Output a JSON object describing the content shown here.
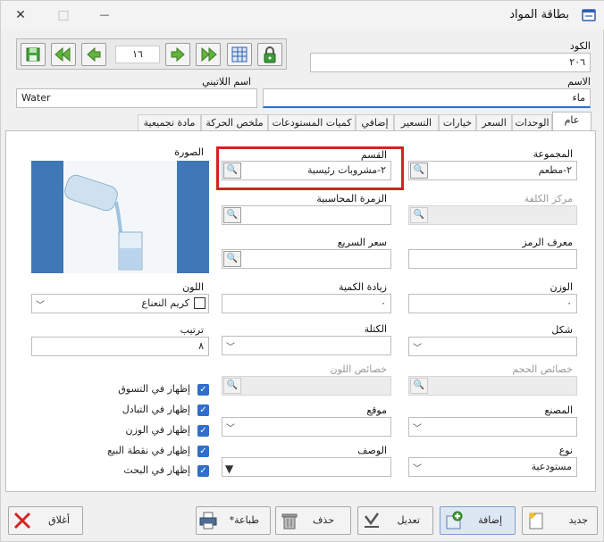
{
  "window": {
    "title": "بطاقة المواد",
    "minimize": "—",
    "maximize": "□",
    "close": "✕"
  },
  "toolbar": {
    "page_number": "١٦"
  },
  "header": {
    "code_label": "الكود",
    "code_value": "٢٠٦",
    "name_label": "الاسم",
    "name_value": "ماء",
    "latin_label": "اسم اللاتيني",
    "latin_value": "Water"
  },
  "tabs": [
    {
      "label": "عام"
    },
    {
      "label": "الوحدات"
    },
    {
      "label": "السعر"
    },
    {
      "label": "خيارات"
    },
    {
      "label": "التسعير"
    },
    {
      "label": "إضافي"
    },
    {
      "label": "كميات المستودعات"
    },
    {
      "label": "ملخص الحركة"
    },
    {
      "label": "مادة تجميعية"
    }
  ],
  "general": {
    "group_label": "المجموعة",
    "group_value": "٢-مطعم",
    "section_label": "القسم",
    "section_value": "٢-مشروبات رئيسية",
    "image_label": "الصورة",
    "cost_center_label": "مركز الكلفة",
    "accounting_group_label": "الزمرة المحاسبية",
    "symbol_id_label": "معرف الرمز",
    "quick_price_label": "سعر السريع",
    "weight_label": "الوزن",
    "weight_value": "٠",
    "qty_increase_label": "زيادة الكمية",
    "qty_increase_value": "٠",
    "color_label": "اللون",
    "color_value": "كريم النعناع",
    "shape_label": "شكل",
    "block_label": "الكتلة",
    "order_label": "ترتيب",
    "order_value": "٨",
    "size_props_label": "خصائص الحجم",
    "color_props_label": "خصائص اللون",
    "manufacturer_label": "المصنع",
    "location_label": "موقع",
    "type_label": "نوع",
    "type_value": "مستودعية",
    "description_label": "الوصف",
    "checks": [
      {
        "label": "إظهار في التسوق",
        "checked": true
      },
      {
        "label": "إظهار في التبادل",
        "checked": true
      },
      {
        "label": "إظهار في الوزن",
        "checked": true
      },
      {
        "label": "إظهار في نقطة البيع",
        "checked": true
      },
      {
        "label": "إظهار في البحث",
        "checked": true
      }
    ]
  },
  "buttons": {
    "new": "جديد",
    "add": "إضافة",
    "edit": "تعديل",
    "delete": "حذف",
    "print": "طباعة*",
    "close": "أغلاق"
  },
  "colors": {
    "accent": "#2a6bd4",
    "highlight": "#d52222",
    "check": "#2f6ecb",
    "image_blue": "#3f78b4"
  }
}
